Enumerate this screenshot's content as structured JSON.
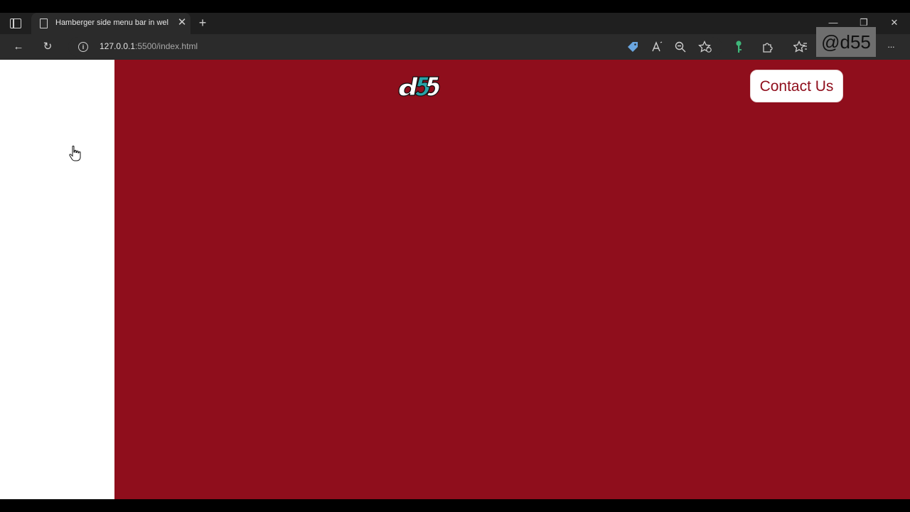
{
  "browser": {
    "tab": {
      "title": "Hamberger side menu bar in wel",
      "close_glyph": "✕",
      "icon": "page-icon"
    },
    "new_tab_glyph": "+",
    "window_controls": {
      "minimize": "—",
      "restore": "❐",
      "close": "✕"
    },
    "toolbar": {
      "back_glyph": "←",
      "reload_glyph": "↻",
      "url_host": "127.0.0.1",
      "url_rest": ":5500/index.html",
      "info_glyph": "i",
      "icons": [
        "tag-icon",
        "read-aloud-icon",
        "zoom-icon",
        "favorite-add-icon",
        "key-icon",
        "extensions-icon",
        "favorites-icon",
        "more-icon"
      ],
      "more_glyph": "···"
    },
    "watermark": "@d55"
  },
  "page": {
    "logo_text": "d55",
    "contact_button": "Contact Us",
    "colors": {
      "hero_background": "#8f0e1c",
      "side_panel": "#ffffff",
      "button_text": "#8f0e1c",
      "logo_accent": "#2aa3a8"
    }
  }
}
